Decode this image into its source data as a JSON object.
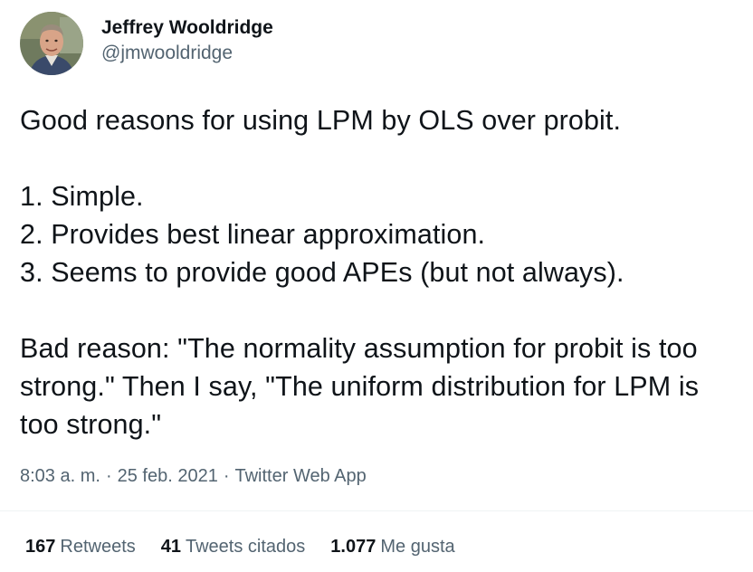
{
  "author": {
    "display_name": "Jeffrey Wooldridge",
    "handle": "@jmwooldridge"
  },
  "tweet": {
    "text": "Good reasons for using LPM by OLS over probit.\n\n1. Simple.\n2. Provides best linear approximation.\n3. Seems to provide good APEs (but not always).\n\nBad reason: \"The normality assumption for probit is too strong.\" Then I say, \"The uniform distribution for LPM is too strong.\""
  },
  "meta": {
    "time": "8:03 a. m.",
    "separator": "·",
    "date": "25 feb. 2021",
    "source": "Twitter Web App"
  },
  "stats": {
    "retweets": {
      "count": "167",
      "label": "Retweets"
    },
    "quotes": {
      "count": "41",
      "label": "Tweets citados"
    },
    "likes": {
      "count": "1.077",
      "label": "Me gusta"
    }
  },
  "colors": {
    "text_primary": "#0f1419",
    "text_secondary": "#536471",
    "divider": "#eff3f4"
  }
}
